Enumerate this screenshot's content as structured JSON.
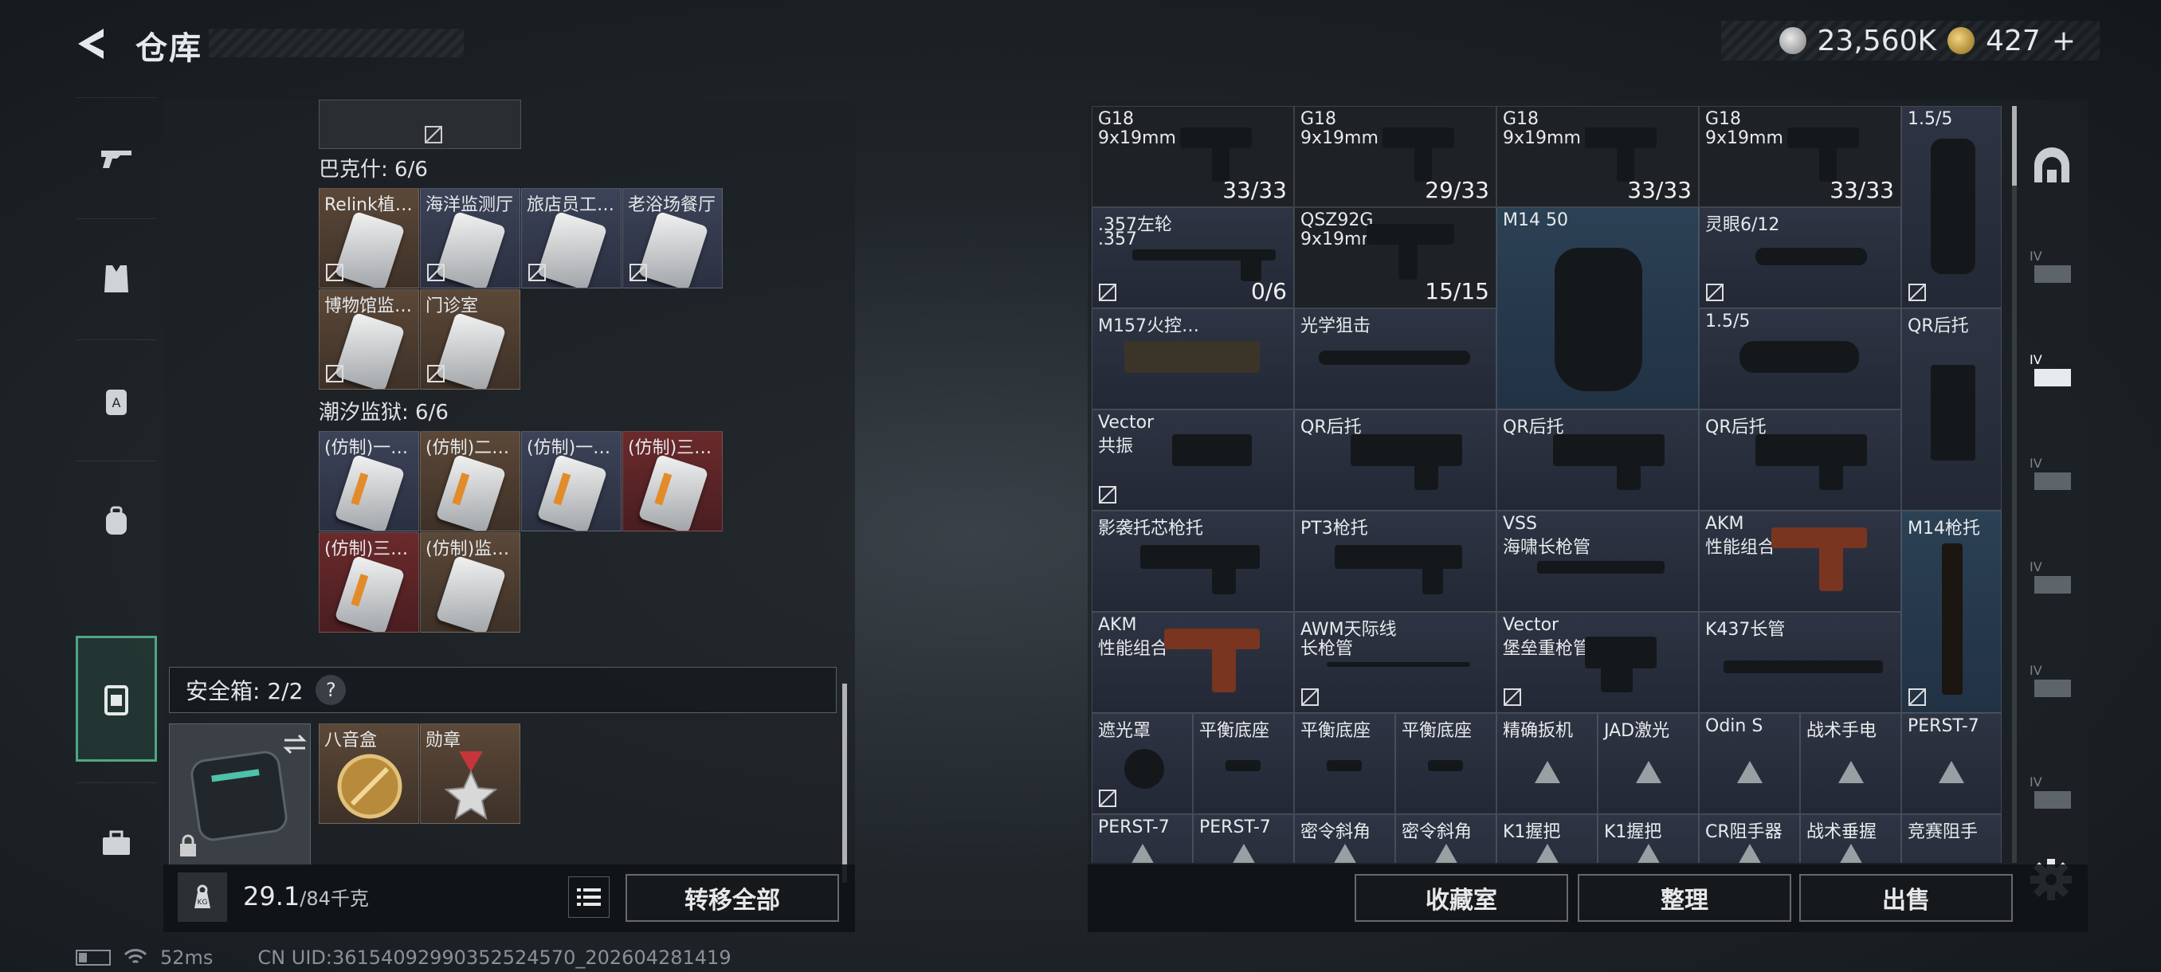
{
  "header": {
    "title": "仓库"
  },
  "currency": {
    "silver": "23,560K",
    "gold": "427",
    "add_icon": "plus"
  },
  "categories": [
    {
      "icon": "gun-icon",
      "active": false
    },
    {
      "icon": "armor-vest-icon",
      "active": false
    },
    {
      "icon": "backpack-a-icon",
      "active": false
    },
    {
      "icon": "backpack-icon",
      "active": false
    },
    {
      "icon": "secure-case-icon",
      "active": true
    },
    {
      "icon": "toolbox-icon",
      "active": false
    }
  ],
  "left": {
    "groups": [
      {
        "title": "巴克什: 6/6",
        "items": [
          "Relink植…",
          "海洋监测厅",
          "旅店员工…",
          "老浴场餐厅",
          "博物馆监…",
          "门诊室"
        ]
      },
      {
        "title": "潮汐监狱: 6/6",
        "items": [
          "(仿制)一…",
          "(仿制)二…",
          "(仿制)一…",
          "(仿制)三…",
          "(仿制)三…",
          "(仿制)监…"
        ]
      }
    ],
    "safe_box": {
      "label": "安全箱: 2/2",
      "help": "?",
      "items": [
        "八音盒",
        "勋章"
      ]
    },
    "weight": {
      "value": "29.1",
      "max": "/84千克"
    },
    "transfer_all": "转移全部"
  },
  "inventory": [
    {
      "n1": "G18",
      "n2": "9x19mm",
      "count": "33/33"
    },
    {
      "n1": "G18",
      "n2": "9x19mm",
      "count": "29/33"
    },
    {
      "n1": "G18",
      "n2": "9x19mm",
      "count": "33/33"
    },
    {
      "n1": "G18",
      "n2": "9x19mm",
      "count": "33/33"
    },
    {
      "n1": "1.5/5",
      "n2": "",
      "count": ""
    },
    {
      "n1": ".357左轮",
      "n2": ".357",
      "count": "0/6"
    },
    {
      "n1": "QSZ92G",
      "n2": "9x19mm",
      "count": "15/15"
    },
    {
      "n1": "M14 50",
      "n2": "",
      "count": ""
    },
    {
      "n1": "灵眼6/12",
      "n2": "",
      "count": ""
    },
    {
      "n1": "M157火控…",
      "n2": "",
      "count": ""
    },
    {
      "n1": "光学狙击",
      "n2": "",
      "count": ""
    },
    {
      "n1": "1.5/5",
      "n2": "",
      "count": ""
    },
    {
      "n1": "QR后托",
      "n2": "",
      "count": ""
    },
    {
      "n1": "Vector",
      "n2": "共振",
      "count": ""
    },
    {
      "n1": "QR后托",
      "n2": "",
      "count": ""
    },
    {
      "n1": "QR后托",
      "n2": "",
      "count": ""
    },
    {
      "n1": "QR后托",
      "n2": "",
      "count": ""
    },
    {
      "n1": "影袭托芯枪托",
      "n2": "",
      "count": ""
    },
    {
      "n1": "PT3枪托",
      "n2": "",
      "count": ""
    },
    {
      "n1": "VSS",
      "n2": "海啸长枪管",
      "count": ""
    },
    {
      "n1": "AKM",
      "n2": "性能组合",
      "count": ""
    },
    {
      "n1": "M14枪托",
      "n2": "",
      "count": ""
    },
    {
      "n1": "AKM",
      "n2": "性能组合",
      "count": ""
    },
    {
      "n1": "AWM天际线",
      "n2": "长枪管",
      "count": ""
    },
    {
      "n1": "Vector",
      "n2": "堡垒重枪管",
      "count": ""
    },
    {
      "n1": "K437长管",
      "n2": "",
      "count": ""
    },
    {
      "n1": "遮光罩",
      "n2": "",
      "count": ""
    },
    {
      "n1": "平衡底座",
      "n2": "",
      "count": ""
    },
    {
      "n1": "平衡底座",
      "n2": "",
      "count": ""
    },
    {
      "n1": "平衡底座",
      "n2": "",
      "count": ""
    },
    {
      "n1": "精确扳机",
      "n2": "",
      "count": ""
    },
    {
      "n1": "JAD激光",
      "n2": "",
      "count": ""
    },
    {
      "n1": "Odin S",
      "n2": "",
      "count": ""
    },
    {
      "n1": "战术手电",
      "n2": "",
      "count": ""
    },
    {
      "n1": "PERST-7",
      "n2": "",
      "count": ""
    },
    {
      "n1": "PERST-7",
      "n2": "",
      "count": ""
    },
    {
      "n1": "PERST-7",
      "n2": "",
      "count": ""
    },
    {
      "n1": "密令斜角",
      "n2": "",
      "count": ""
    },
    {
      "n1": "密令斜角",
      "n2": "",
      "count": ""
    },
    {
      "n1": "K1握把",
      "n2": "",
      "count": ""
    },
    {
      "n1": "K1握把",
      "n2": "",
      "count": ""
    },
    {
      "n1": "CR阻手器",
      "n2": "",
      "count": ""
    },
    {
      "n1": "战术垂握",
      "n2": "",
      "count": ""
    },
    {
      "n1": "竞赛阻手",
      "n2": "",
      "count": ""
    }
  ],
  "bottom_buttons": {
    "collection": "收藏室",
    "sort": "整理",
    "sell": "出售"
  },
  "side_tabs": [
    "IV",
    "IV",
    "IV",
    "IV",
    "IV",
    "IV"
  ],
  "status": {
    "ping": "52ms",
    "uid": "CN UID:3615409299035252​4570_202604281419"
  }
}
